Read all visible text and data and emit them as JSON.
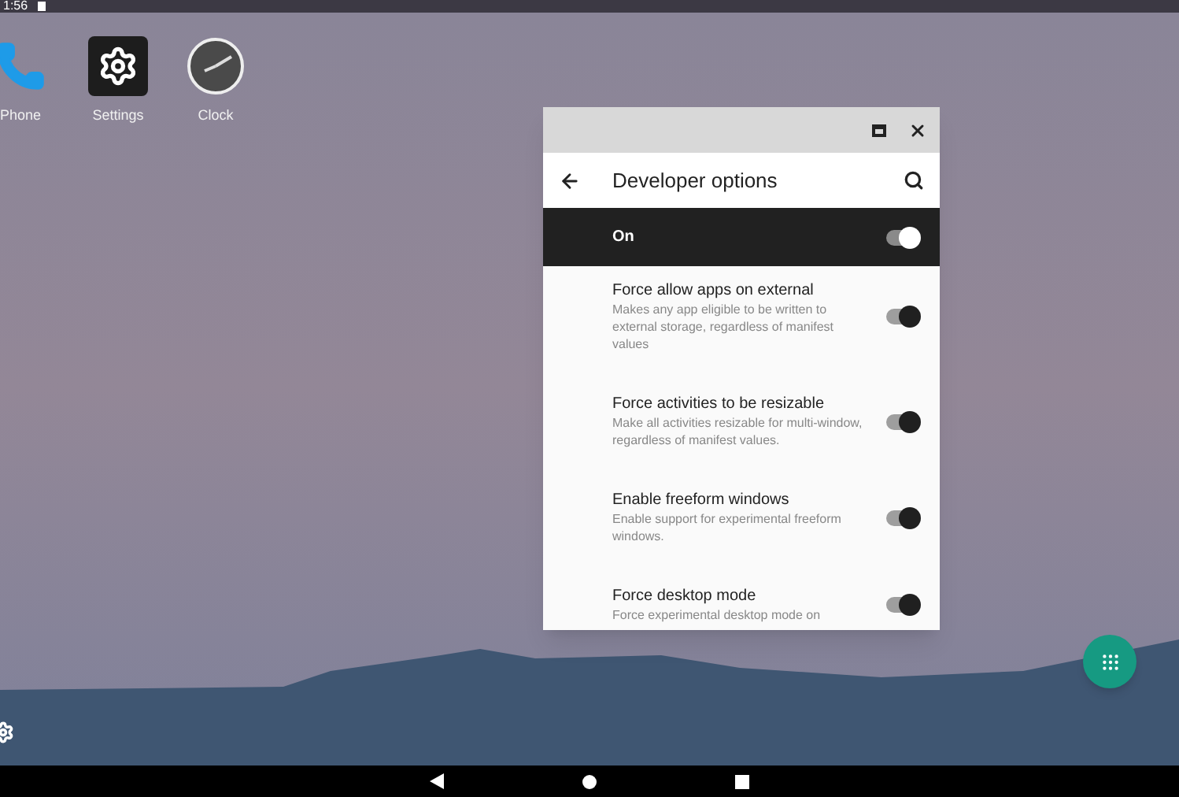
{
  "status_bar": {
    "time": "1:56"
  },
  "desktop_icons": [
    {
      "kind": "phone",
      "label": "Phone"
    },
    {
      "kind": "settings",
      "label": "Settings"
    },
    {
      "kind": "clock",
      "label": "Clock"
    }
  ],
  "window": {
    "title": "Developer options",
    "master": {
      "label": "On",
      "on": true
    },
    "settings": [
      {
        "title": "Force allow apps on external",
        "summary": "Makes any app eligible to be written to external storage, regardless of manifest values",
        "on": true
      },
      {
        "title": "Force activities to be resizable",
        "summary": "Make all activities resizable for multi-window, regardless of manifest values.",
        "on": true
      },
      {
        "title": "Enable freeform windows",
        "summary": "Enable support for experimental freeform windows.",
        "on": true
      },
      {
        "title": "Force desktop mode",
        "summary": "Force experimental desktop mode on",
        "on": true
      }
    ]
  }
}
